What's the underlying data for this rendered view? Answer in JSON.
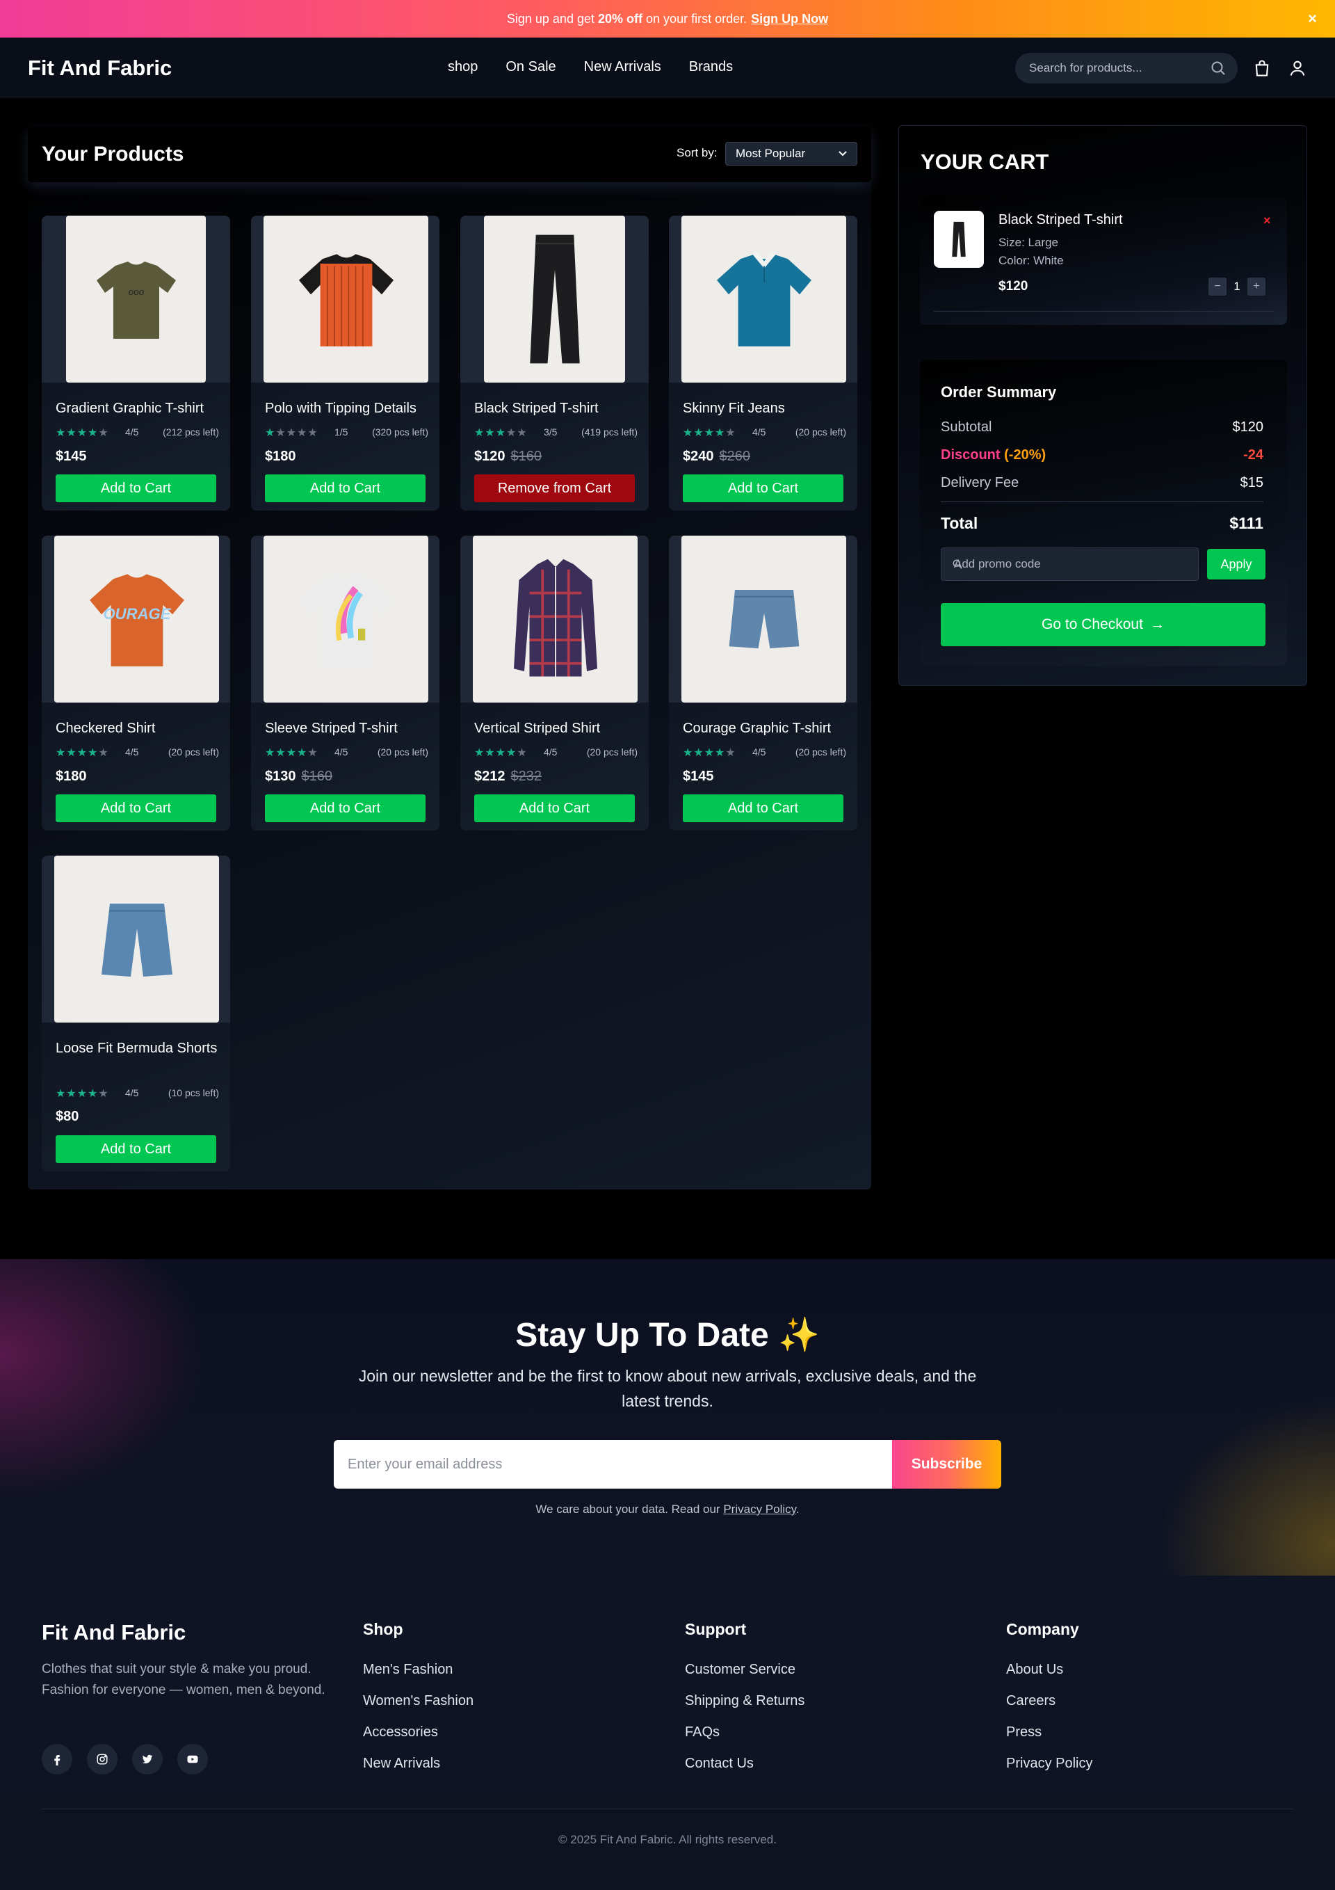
{
  "promo": {
    "text_before": "Sign up and get",
    "highlight": "20% off",
    "text_after": "on your first order.",
    "link": "Sign Up Now",
    "close": "×"
  },
  "header": {
    "logo": "Fit And Fabric",
    "nav": [
      "shop",
      "On Sale",
      "New Arrivals",
      "Brands"
    ],
    "search_placeholder": "Search for products...",
    "icons": [
      "search-icon",
      "cart-icon",
      "user-icon"
    ]
  },
  "products": {
    "title": "Your Products",
    "sort_label": "Sort by:",
    "sort_value": "Most Popular",
    "items": [
      {
        "name": "Gradient Graphic T-shirt",
        "rating_value": 4,
        "rating": "4/5",
        "stock": "(212 pcs left)",
        "price": "$145",
        "old_price": "",
        "button": "Add to Cart",
        "in_cart": false,
        "image": "olive-tshirt"
      },
      {
        "name": "Polo with Tipping Details",
        "rating_value": 1,
        "rating": "1/5",
        "stock": "(320 pcs left)",
        "price": "$180",
        "old_price": "",
        "button": "Add to Cart",
        "in_cart": false,
        "image": "orange-striped-tshirt"
      },
      {
        "name": "Black Striped T-shirt",
        "rating_value": 3,
        "rating": "3/5",
        "stock": "(419 pcs left)",
        "price": "$120",
        "old_price": "$160",
        "button": "Remove from Cart",
        "in_cart": true,
        "image": "black-jeans"
      },
      {
        "name": "Skinny Fit Jeans",
        "rating_value": 4,
        "rating": "4/5",
        "stock": "(20 pcs left)",
        "price": "$240",
        "old_price": "$260",
        "button": "Add to Cart",
        "in_cart": false,
        "image": "blue-polo"
      },
      {
        "name": "Checkered Shirt",
        "rating_value": 4,
        "rating": "4/5",
        "stock": "(20 pcs left)",
        "price": "$180",
        "old_price": "",
        "button": "Add to Cart",
        "in_cart": false,
        "image": "orange-courage-tshirt"
      },
      {
        "name": "Sleeve Striped T-shirt",
        "rating_value": 4,
        "rating": "4/5",
        "stock": "(20 pcs left)",
        "price": "$130",
        "old_price": "$160",
        "button": "Add to Cart",
        "in_cart": false,
        "image": "white-graphic-tshirt"
      },
      {
        "name": "Vertical Striped Shirt",
        "rating_value": 4,
        "rating": "4/5",
        "stock": "(20 pcs left)",
        "price": "$212",
        "old_price": "$232",
        "button": "Add to Cart",
        "in_cart": false,
        "image": "plaid-shirt"
      },
      {
        "name": "Courage Graphic T-shirt",
        "rating_value": 4,
        "rating": "4/5",
        "stock": "(20 pcs left)",
        "price": "$145",
        "old_price": "",
        "button": "Add to Cart",
        "in_cart": false,
        "image": "denim-shorts"
      },
      {
        "name": "Loose Fit Bermuda Shorts",
        "rating_value": 4,
        "rating": "4/5",
        "stock": "(10 pcs left)",
        "price": "$80",
        "old_price": "",
        "button": "Add to Cart",
        "in_cart": false,
        "image": "denim-bermuda-shorts"
      }
    ]
  },
  "cart": {
    "title": "YOUR CART",
    "item": {
      "name": "Black Striped T-shirt",
      "size": "Size: Large",
      "color": "Color: White",
      "price": "$120",
      "quantity": "1",
      "remove": "×",
      "minus": "−",
      "plus": "+"
    },
    "summary": {
      "title": "Order Summary",
      "subtotal_label": "Subtotal",
      "subtotal": "$120",
      "discount_label": "Discount",
      "discount_pct": "(-20%)",
      "discount": "-24",
      "delivery_label": "Delivery Fee",
      "delivery": "$15",
      "total_label": "Total",
      "total": "$111",
      "promo_placeholder": "Add promo code",
      "apply": "Apply",
      "checkout": "Go to Checkout",
      "checkout_arrow": "→"
    }
  },
  "newsletter": {
    "title": "Stay Up To Date ✨",
    "subtitle": "Join our newsletter and be the first to know about new arrivals, exclusive deals, and the latest trends.",
    "placeholder": "Enter your email address",
    "button": "Subscribe",
    "privacy_text": "We care about your data. Read our",
    "privacy_link": "Privacy Policy",
    "privacy_end": "."
  },
  "footer": {
    "brand": "Fit And Fabric",
    "description": "Clothes that suit your style & make you proud. Fashion for everyone — women, men & beyond.",
    "socials": [
      "facebook-icon",
      "instagram-icon",
      "twitter-icon",
      "youtube-icon"
    ],
    "columns": [
      {
        "title": "Shop",
        "links": [
          "Men's Fashion",
          "Women's Fashion",
          "Accessories",
          "New Arrivals"
        ]
      },
      {
        "title": "Support",
        "links": [
          "Customer Service",
          "Shipping & Returns",
          "FAQs",
          "Contact Us"
        ]
      },
      {
        "title": "Company",
        "links": [
          "About Us",
          "Careers",
          "Press",
          "Privacy Policy"
        ]
      }
    ],
    "copyright": "© 2025 Fit And Fabric. All rights reserved."
  },
  "colors": {
    "accent_green": "#01c752",
    "remove_red": "#a0080f",
    "star": "#19b38a",
    "discount_pink": "#ff3f8b",
    "discount_orange": "#ffa011"
  }
}
